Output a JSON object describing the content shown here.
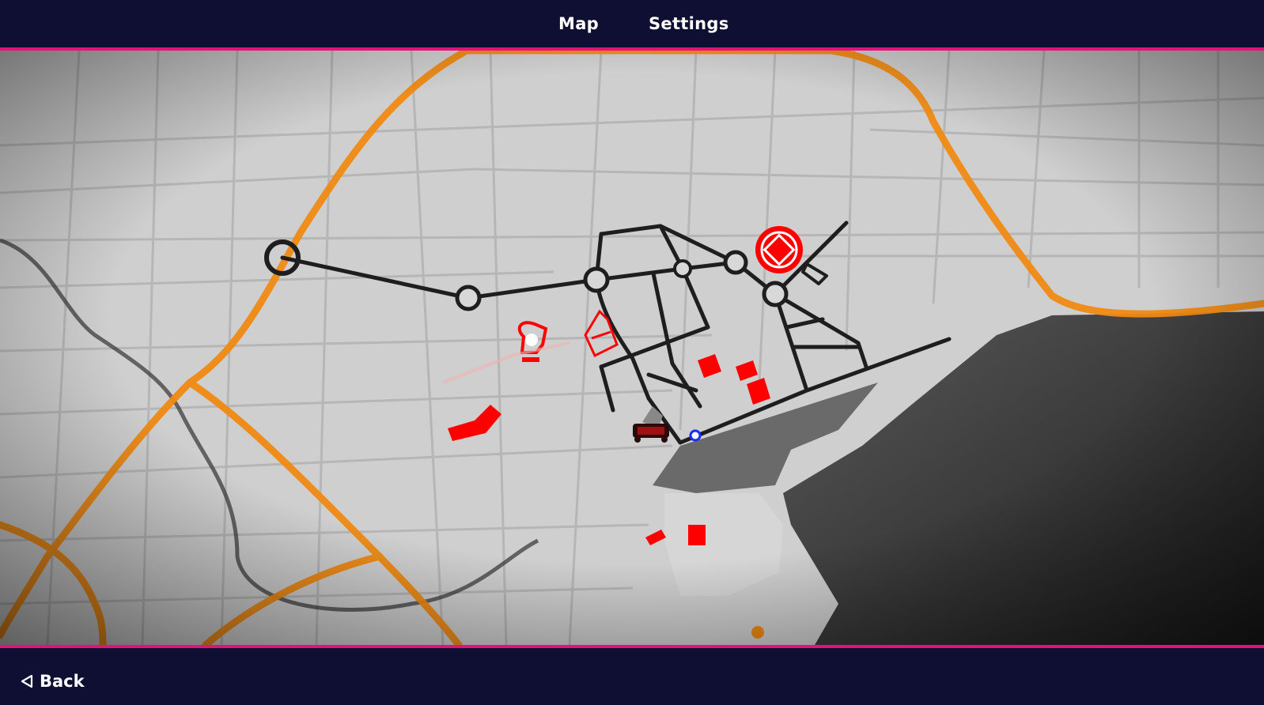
{
  "header": {
    "tabs": [
      {
        "label": "Map"
      },
      {
        "label": "Settings"
      }
    ]
  },
  "footer": {
    "back_label": "Back",
    "back_icon": "triangle-left-icon"
  },
  "map": {
    "colors": {
      "land": "#cfcfcf",
      "water": "#2e2e2e",
      "highway": "#f08a12",
      "route": "#1e1e1e",
      "zone": "#ff0000",
      "accent": "#e0137a",
      "player_marker": "#1a2cff"
    },
    "icons": [
      "station-node-icon",
      "objective-marker-icon",
      "player-marker-icon",
      "vehicle-icon",
      "zone-marker-icon"
    ]
  }
}
